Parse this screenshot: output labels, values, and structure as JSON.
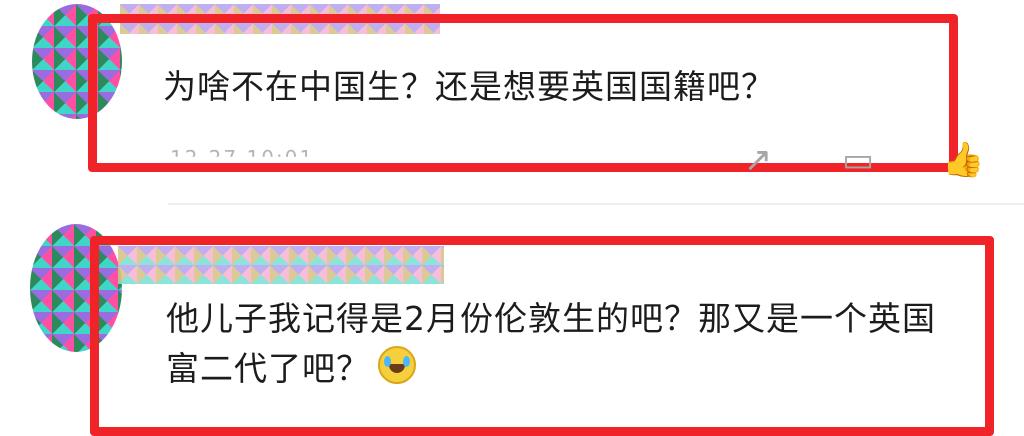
{
  "comments": [
    {
      "text": "为啥不在中国生？还是想要英国国籍吧？",
      "timestamp": "12-27 10:01"
    },
    {
      "text": "他儿子我记得是2月份伦敦生的吧？那又是一个英国富二代了吧？"
    }
  ],
  "icons": {
    "share": "share-icon",
    "reply": "reply-icon",
    "like": "like-icon"
  },
  "colors": {
    "highlight": "#ef2328"
  }
}
